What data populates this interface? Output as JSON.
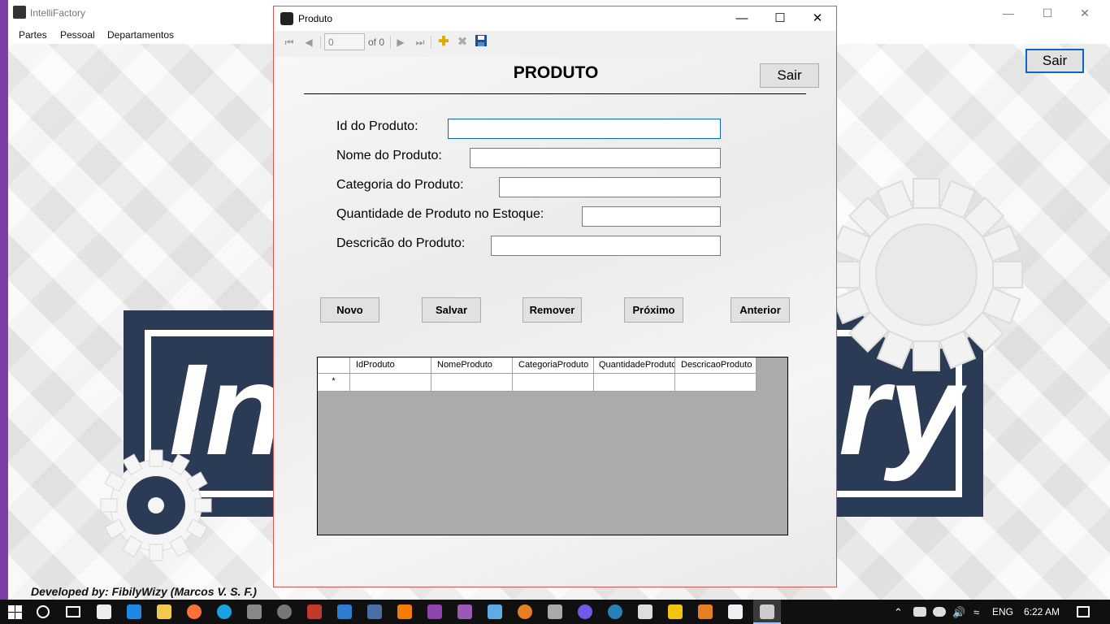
{
  "main_window": {
    "title": "IntelliFactory",
    "menu": [
      "Partes",
      "Pessoal",
      "Departamentos"
    ],
    "sair_label": "Sair",
    "logo_left": "In",
    "logo_right": "ry",
    "developed_by": "Developed by: FibilyWizy (Marcos V. S. F.)"
  },
  "dialog": {
    "title": "Produto",
    "navigator": {
      "position": "0",
      "of_label": "of 0"
    },
    "heading": "PRODUTO",
    "sair_label": "Sair",
    "fields": [
      {
        "label": "Id do Produto:",
        "value": ""
      },
      {
        "label": "Nome do Produto:",
        "value": ""
      },
      {
        "label": "Categoria do Produto:",
        "value": ""
      },
      {
        "label": "Quantidade de Produto no Estoque:",
        "value": ""
      },
      {
        "label": "Descricão do Produto:",
        "value": ""
      }
    ],
    "buttons": [
      "Novo",
      "Salvar",
      "Remover",
      "Próximo",
      "Anterior"
    ],
    "grid": {
      "columns": [
        "IdProduto",
        "NomeProduto",
        "CategoriaProduto",
        "QuantidadeProduto",
        "DescricaoProduto"
      ],
      "new_row_marker": "*"
    }
  },
  "taskbar": {
    "language": "ENG",
    "time": "6:22 AM"
  },
  "colors": {
    "logo_navy": "#2b3a55",
    "accent_blue": "#0a66c2",
    "dialog_border": "#d9534f"
  }
}
